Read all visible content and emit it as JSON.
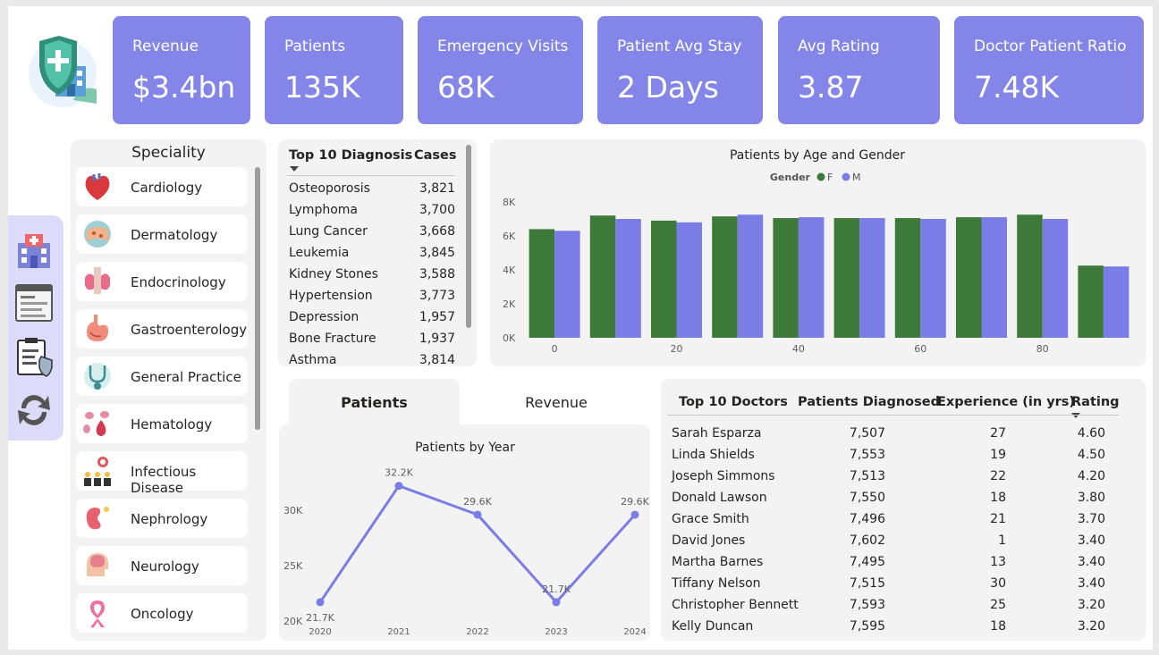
{
  "kpis": [
    {
      "label": "Revenue",
      "value": "$3.4bn"
    },
    {
      "label": "Patients",
      "value": "135K"
    },
    {
      "label": "Emergency Visits",
      "value": "68K"
    },
    {
      "label": "Patient Avg Stay",
      "value": "2 Days"
    },
    {
      "label": "Avg Rating",
      "value": "3.87"
    },
    {
      "label": "Doctor Patient Ratio",
      "value": "7.48K"
    }
  ],
  "nav_icons": [
    "hospital-icon",
    "report-page-icon",
    "clipboard-shield-icon",
    "refresh-icon"
  ],
  "speciality": {
    "title": "Speciality",
    "items": [
      {
        "label": "Cardiology",
        "icon": "heart-icon"
      },
      {
        "label": "Dermatology",
        "icon": "skin-icon"
      },
      {
        "label": "Endocrinology",
        "icon": "thyroid-icon"
      },
      {
        "label": "Gastroenterology",
        "icon": "stomach-icon"
      },
      {
        "label": "General Practice",
        "icon": "stethoscope-icon"
      },
      {
        "label": "Hematology",
        "icon": "blood-cells-icon"
      },
      {
        "label": "Infectious Disease",
        "icon": "virus-icon"
      },
      {
        "label": "Nephrology",
        "icon": "kidney-icon"
      },
      {
        "label": "Neurology",
        "icon": "brain-icon"
      },
      {
        "label": "Oncology",
        "icon": "ribbon-icon"
      }
    ]
  },
  "diagnosis": {
    "header_name": "Top 10 Diagnosis",
    "header_cases": "Cases",
    "rows": [
      {
        "name": "Osteoporosis",
        "cases": "3,821"
      },
      {
        "name": "Lymphoma",
        "cases": "3,700"
      },
      {
        "name": "Lung Cancer",
        "cases": "3,668"
      },
      {
        "name": "Leukemia",
        "cases": "3,845"
      },
      {
        "name": "Kidney Stones",
        "cases": "3,588"
      },
      {
        "name": "Hypertension",
        "cases": "3,773"
      },
      {
        "name": "Depression",
        "cases": "1,957"
      },
      {
        "name": "Bone Fracture",
        "cases": "1,937"
      },
      {
        "name": "Asthma",
        "cases": "3,814"
      }
    ]
  },
  "tabs": {
    "active": "Patients",
    "other": "Revenue"
  },
  "colors": {
    "kpi": "#8386e8",
    "female": "#3d7a3a",
    "male": "#7b7de6"
  },
  "doctors": {
    "headers": [
      "Top 10 Doctors",
      "Patients Diagnosed",
      "Experience (in yrs)",
      "Rating"
    ],
    "rows": [
      {
        "name": "Sarah Esparza",
        "patients": "7,507",
        "exp": "27",
        "rating": "4.60"
      },
      {
        "name": "Linda Shields",
        "patients": "7,553",
        "exp": "19",
        "rating": "4.50"
      },
      {
        "name": "Joseph Simmons",
        "patients": "7,513",
        "exp": "22",
        "rating": "4.20"
      },
      {
        "name": "Donald Lawson",
        "patients": "7,550",
        "exp": "18",
        "rating": "3.80"
      },
      {
        "name": "Grace Smith",
        "patients": "7,496",
        "exp": "21",
        "rating": "3.70"
      },
      {
        "name": "David Jones",
        "patients": "7,602",
        "exp": "1",
        "rating": "3.40"
      },
      {
        "name": "Martha Barnes",
        "patients": "7,495",
        "exp": "13",
        "rating": "3.40"
      },
      {
        "name": "Tiffany Nelson",
        "patients": "7,515",
        "exp": "30",
        "rating": "3.40"
      },
      {
        "name": "Christopher Bennett",
        "patients": "7,593",
        "exp": "25",
        "rating": "3.20"
      },
      {
        "name": "Kelly Duncan",
        "patients": "7,595",
        "exp": "18",
        "rating": "3.20"
      }
    ]
  },
  "chart_data": [
    {
      "type": "bar",
      "title": "Patients by Age and Gender",
      "legend_title": "Gender",
      "legend_position": "top-center",
      "categories": [
        0,
        10,
        20,
        30,
        40,
        50,
        60,
        70,
        80,
        90
      ],
      "x_tick_labels": [
        "0",
        "20",
        "40",
        "60",
        "80"
      ],
      "y_tick_labels": [
        "0K",
        "2K",
        "4K",
        "6K",
        "8K"
      ],
      "ylim": [
        0,
        8000
      ],
      "series": [
        {
          "name": "F",
          "values": [
            6400,
            7200,
            6900,
            7150,
            7050,
            7050,
            7050,
            7100,
            7250,
            4250
          ]
        },
        {
          "name": "M",
          "values": [
            6300,
            7000,
            6800,
            7250,
            7100,
            7050,
            7000,
            7100,
            7000,
            4200
          ]
        }
      ]
    },
    {
      "type": "line",
      "title": "Patients by Year",
      "x": [
        "2020",
        "2021",
        "2022",
        "2023",
        "2024"
      ],
      "values": [
        21700,
        32200,
        29600,
        21700,
        29600
      ],
      "data_labels": [
        "21.7K",
        "32.2K",
        "29.6K",
        "21.7K",
        "29.6K"
      ],
      "y_tick_labels": [
        "20K",
        "25K",
        "30K"
      ],
      "ylim": [
        20000,
        33500
      ]
    }
  ]
}
